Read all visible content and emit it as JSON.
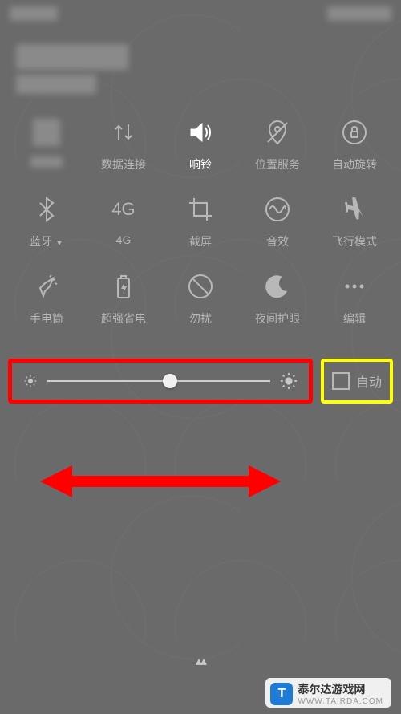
{
  "tiles": {
    "row1": [
      {
        "id": "wlan",
        "label": "",
        "icon": "pixelated"
      },
      {
        "id": "data",
        "label": "数据连接",
        "icon": "updown"
      },
      {
        "id": "sound",
        "label": "响铃",
        "icon": "speaker",
        "active": true
      },
      {
        "id": "location",
        "label": "位置服务",
        "icon": "location-off"
      },
      {
        "id": "rotate",
        "label": "自动旋转",
        "icon": "lock-circle"
      }
    ],
    "row2": [
      {
        "id": "bluetooth",
        "label": "蓝牙",
        "icon": "bluetooth",
        "hasDropdown": true
      },
      {
        "id": "4g",
        "label": "4G",
        "icon": "text4g"
      },
      {
        "id": "screenshot",
        "label": "截屏",
        "icon": "crop"
      },
      {
        "id": "audio",
        "label": "音效",
        "icon": "audio-effect"
      },
      {
        "id": "airplane",
        "label": "飞行模式",
        "icon": "airplane"
      }
    ],
    "row3": [
      {
        "id": "flashlight",
        "label": "手电筒",
        "icon": "flashlight"
      },
      {
        "id": "powersave",
        "label": "超强省电",
        "icon": "battery-charge"
      },
      {
        "id": "dnd",
        "label": "勿扰",
        "icon": "dnd-circle"
      },
      {
        "id": "night",
        "label": "夜间护眼",
        "icon": "moon"
      },
      {
        "id": "edit",
        "label": "编辑",
        "icon": "dots"
      }
    ]
  },
  "brightness": {
    "autoLabel": "自动",
    "autoChecked": false,
    "sliderPercent": 55
  },
  "brand": {
    "name": "泰尔达游戏网",
    "sub": "WWW.TAIRDA.COM"
  },
  "annotations": {
    "sliderHighlight": "red-box",
    "autoHighlight": "yellow-box",
    "dragArrow": "red-double-arrow"
  }
}
